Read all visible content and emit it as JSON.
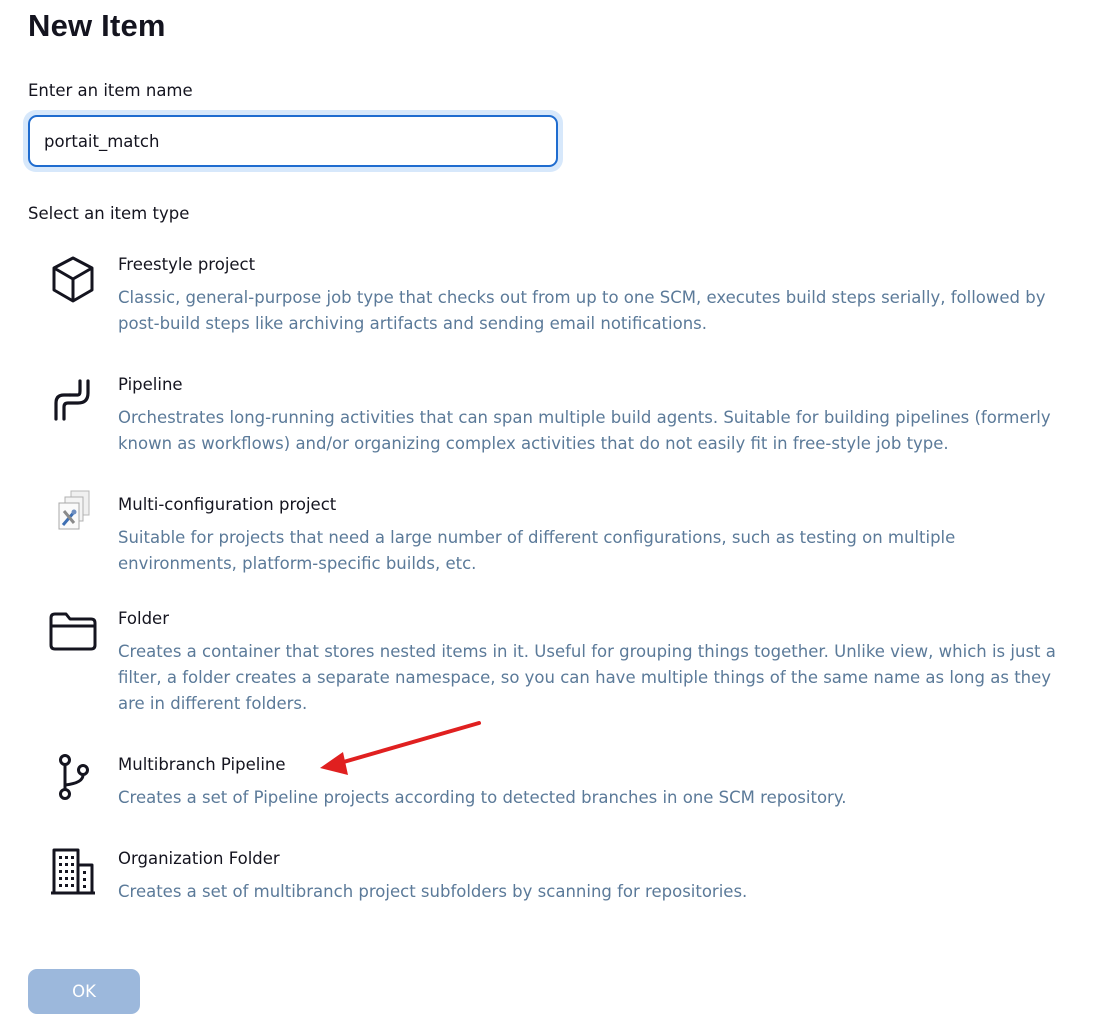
{
  "page": {
    "title": "New Item"
  },
  "name_field": {
    "label": "Enter an item name",
    "value": "portait_match"
  },
  "type_section": {
    "label": "Select an item type"
  },
  "item_types": [
    {
      "title": "Freestyle project",
      "icon": "cube-icon",
      "description": "Classic, general-purpose job type that checks out from up to one SCM, executes build steps serially, followed by post-build steps like archiving artifacts and sending email notifications."
    },
    {
      "title": "Pipeline",
      "icon": "pipeline-icon",
      "description": "Orchestrates long-running activities that can span multiple build agents. Suitable for building pipelines (formerly known as workflows) and/or organizing complex activities that do not easily fit in free-style job type."
    },
    {
      "title": "Multi-configuration project",
      "icon": "multi-config-icon",
      "description": "Suitable for projects that need a large number of different configurations, such as testing on multiple environments, platform-specific builds, etc."
    },
    {
      "title": "Folder",
      "icon": "folder-icon",
      "description": "Creates a container that stores nested items in it. Useful for grouping things together. Unlike view, which is just a filter, a folder creates a separate namespace, so you can have multiple things of the same name as long as they are in different folders."
    },
    {
      "title": "Multibranch Pipeline",
      "icon": "branch-icon",
      "description": "Creates a set of Pipeline projects according to detected branches in one SCM repository."
    },
    {
      "title": "Organization Folder",
      "icon": "building-icon",
      "description": "Creates a set of multibranch project subfolders by scanning for repositories."
    }
  ],
  "ok_button": {
    "label": "OK"
  },
  "colors": {
    "accent": "#1f6ccf",
    "description_text": "#5b7a99",
    "ok_button": "#9cb8dc",
    "annotation_arrow": "#e02020"
  }
}
